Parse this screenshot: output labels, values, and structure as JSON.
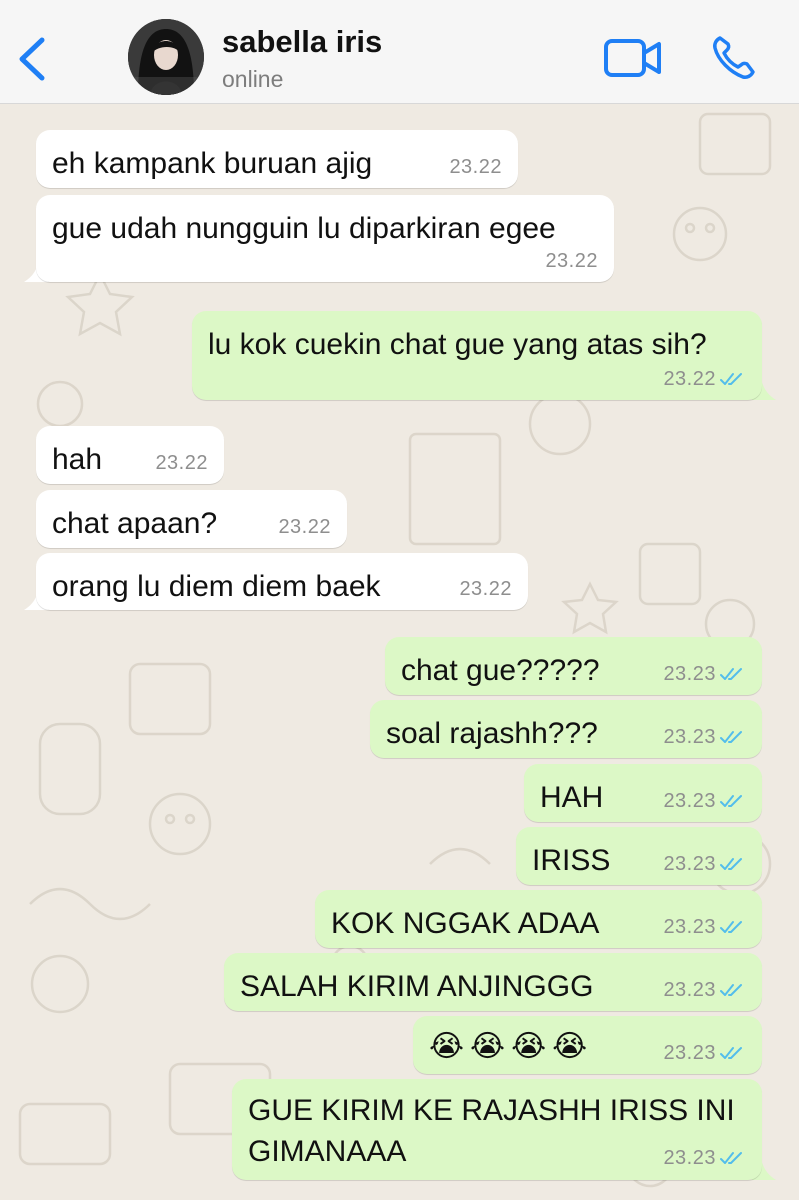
{
  "header": {
    "contact_name": "sabella iris",
    "status": "online"
  },
  "messages": [
    {
      "dir": "in",
      "text": "eh kampank buruan ajig",
      "time": "23.22"
    },
    {
      "dir": "in",
      "text": "gue udah nungguin lu diparkiran egee",
      "time": "23.22"
    },
    {
      "dir": "out",
      "text": "lu kok cuekin chat gue yang atas sih?",
      "time": "23.22",
      "status": "read"
    },
    {
      "dir": "in",
      "text": "hah",
      "time": "23.22"
    },
    {
      "dir": "in",
      "text": "chat apaan?",
      "time": "23.22"
    },
    {
      "dir": "in",
      "text": "orang lu diem diem baek",
      "time": "23.22"
    },
    {
      "dir": "out",
      "text": "chat gue?????",
      "time": "23.23",
      "status": "read"
    },
    {
      "dir": "out",
      "text": "soal rajashh???",
      "time": "23.23",
      "status": "read"
    },
    {
      "dir": "out",
      "text": "HAH",
      "time": "23.23",
      "status": "read"
    },
    {
      "dir": "out",
      "text": "IRISS",
      "time": "23.23",
      "status": "read"
    },
    {
      "dir": "out",
      "text": "KOK NGGAK ADAA",
      "time": "23.23",
      "status": "read"
    },
    {
      "dir": "out",
      "text": "SALAH KIRIM ANJINGGG",
      "time": "23.23",
      "status": "read"
    },
    {
      "dir": "out",
      "text": "😭😭😭😭",
      "time": "23.23",
      "status": "read"
    },
    {
      "dir": "out",
      "text": "GUE KIRIM KE RAJASHH IRISS INI GIMANAAA",
      "time": "23.23",
      "status": "read"
    }
  ],
  "colors": {
    "accent": "#1f7ff5",
    "incoming_bubble": "#ffffff",
    "outgoing_bubble": "#dcf8c6",
    "read_ticks": "#53bdeb",
    "wallpaper": "#efeae2"
  },
  "icons": {
    "back": "chevron-left-icon",
    "video": "video-camera-icon",
    "call": "phone-icon",
    "read_receipt": "double-check-icon"
  }
}
